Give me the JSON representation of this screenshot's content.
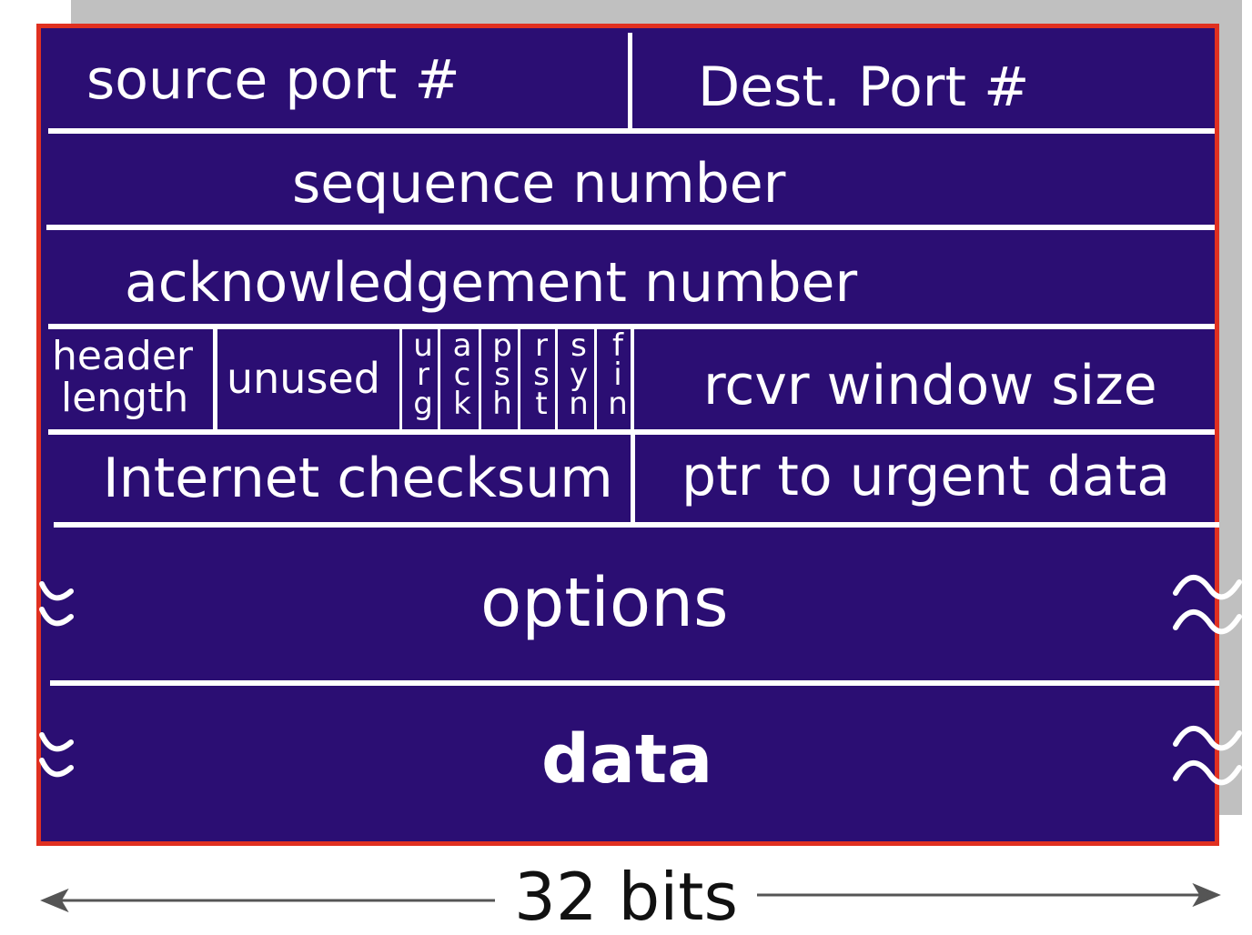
{
  "fields": {
    "source_port": "source port #",
    "dest_port": "Dest. Port  #",
    "sequence_number": "sequence number",
    "ack_number": "acknowledgement number",
    "header_length_line1": "header",
    "header_length_line2": "length",
    "unused": "unused",
    "flags": [
      {
        "name": "urg",
        "letters": [
          "u",
          "r",
          "g"
        ]
      },
      {
        "name": "ack",
        "letters": [
          "a",
          "c",
          "k"
        ]
      },
      {
        "name": "psh",
        "letters": [
          "p",
          "s",
          "h"
        ]
      },
      {
        "name": "rst",
        "letters": [
          "r",
          "s",
          "t"
        ]
      },
      {
        "name": "syn",
        "letters": [
          "s",
          "y",
          "n"
        ]
      },
      {
        "name": "fin",
        "letters": [
          "f",
          "i",
          "n"
        ]
      }
    ],
    "rcvr_window": "rcvr window size",
    "checksum": "Internet checksum",
    "urgent_ptr": "ptr to urgent data",
    "options": "options",
    "data": "data"
  },
  "width_label": "32 bits",
  "colors": {
    "fill": "#2b0e73",
    "border": "#e03020",
    "shadow": "#c0c0c0",
    "text": "#ffffff"
  }
}
